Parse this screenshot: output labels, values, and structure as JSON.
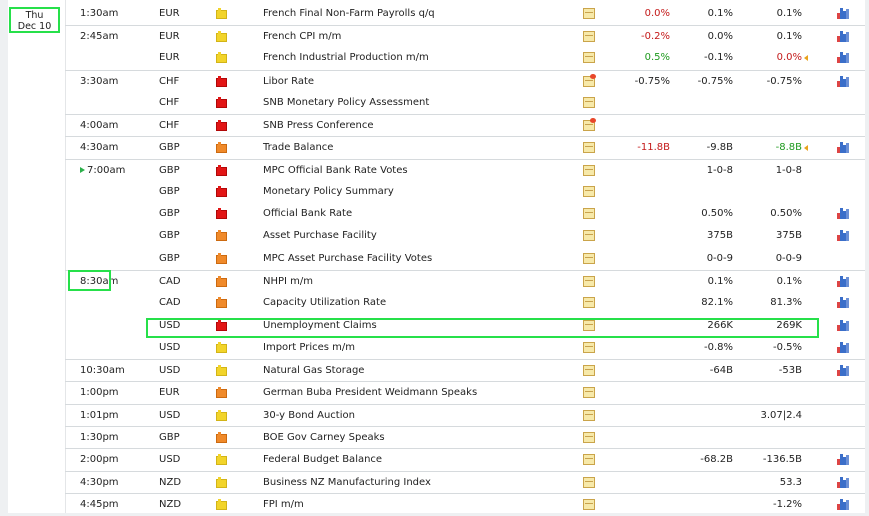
{
  "day": {
    "weekday": "Thu",
    "date": "Dec 10"
  },
  "rows": [
    {
      "time": "1:30am",
      "currency": "EUR",
      "impact": "low",
      "event": "French Final Non-Farm Payrolls q/q",
      "doc": "note",
      "actual": "0.0%",
      "actual_color": "red",
      "forecast": "0.1%",
      "previous": "0.1%",
      "previous_color": "",
      "chart": true,
      "sep": false
    },
    {
      "time": "2:45am",
      "currency": "EUR",
      "impact": "low",
      "event": "French CPI m/m",
      "doc": "note",
      "actual": "-0.2%",
      "actual_color": "red",
      "forecast": "0.0%",
      "previous": "0.1%",
      "previous_color": "",
      "chart": true,
      "sep": true
    },
    {
      "time": "",
      "currency": "EUR",
      "impact": "low",
      "event": "French Industrial Production m/m",
      "doc": "note",
      "actual": "0.5%",
      "actual_color": "green",
      "forecast": "-0.1%",
      "previous": "0.0%",
      "previous_color": "red",
      "revised": true,
      "chart": true,
      "sep": false
    },
    {
      "time": "3:30am",
      "currency": "CHF",
      "impact": "high",
      "event": "Libor Rate",
      "doc": "note-new",
      "actual": "-0.75%",
      "actual_color": "",
      "forecast": "-0.75%",
      "previous": "-0.75%",
      "previous_color": "",
      "chart": true,
      "sep": true
    },
    {
      "time": "",
      "currency": "CHF",
      "impact": "high",
      "event": "SNB Monetary Policy Assessment",
      "doc": "note",
      "actual": "",
      "actual_color": "",
      "forecast": "",
      "previous": "",
      "previous_color": "",
      "chart": false,
      "sep": false
    },
    {
      "time": "4:00am",
      "currency": "CHF",
      "impact": "high",
      "event": "SNB Press Conference",
      "doc": "note-new",
      "actual": "",
      "actual_color": "",
      "forecast": "",
      "previous": "",
      "previous_color": "",
      "chart": false,
      "sep": true
    },
    {
      "time": "4:30am",
      "currency": "GBP",
      "impact": "medium",
      "event": "Trade Balance",
      "doc": "note",
      "actual": "-11.8B",
      "actual_color": "red",
      "forecast": "-9.8B",
      "previous": "-8.8B",
      "previous_color": "green",
      "revised": true,
      "chart": true,
      "sep": true
    },
    {
      "time": "7:00am",
      "currency": "GBP",
      "impact": "high",
      "event": "MPC Official Bank Rate Votes",
      "doc": "note",
      "actual": "",
      "actual_color": "",
      "forecast": "1-0-8",
      "previous": "1-0-8",
      "previous_color": "",
      "chart": false,
      "sep": true,
      "playing": true
    },
    {
      "time": "",
      "currency": "GBP",
      "impact": "high",
      "event": "Monetary Policy Summary",
      "doc": "note",
      "actual": "",
      "actual_color": "",
      "forecast": "",
      "previous": "",
      "previous_color": "",
      "chart": false,
      "sep": false
    },
    {
      "time": "",
      "currency": "GBP",
      "impact": "high",
      "event": "Official Bank Rate",
      "doc": "note",
      "actual": "",
      "actual_color": "",
      "forecast": "0.50%",
      "previous": "0.50%",
      "previous_color": "",
      "chart": true,
      "sep": false
    },
    {
      "time": "",
      "currency": "GBP",
      "impact": "medium",
      "event": "Asset Purchase Facility",
      "doc": "note",
      "actual": "",
      "actual_color": "",
      "forecast": "375B",
      "previous": "375B",
      "previous_color": "",
      "chart": true,
      "sep": false
    },
    {
      "time": "",
      "currency": "GBP",
      "impact": "medium",
      "event": "MPC Asset Purchase Facility Votes",
      "doc": "note",
      "actual": "",
      "actual_color": "",
      "forecast": "0-0-9",
      "previous": "0-0-9",
      "previous_color": "",
      "chart": false,
      "sep": false
    },
    {
      "time": "8:30am",
      "currency": "CAD",
      "impact": "medium",
      "event": "NHPI m/m",
      "doc": "note",
      "actual": "",
      "actual_color": "",
      "forecast": "0.1%",
      "previous": "0.1%",
      "previous_color": "",
      "chart": true,
      "sep": true
    },
    {
      "time": "",
      "currency": "CAD",
      "impact": "medium",
      "event": "Capacity Utilization Rate",
      "doc": "note",
      "actual": "",
      "actual_color": "",
      "forecast": "82.1%",
      "previous": "81.3%",
      "previous_color": "",
      "chart": true,
      "sep": false
    },
    {
      "time": "",
      "currency": "USD",
      "impact": "high",
      "event": "Unemployment Claims",
      "doc": "note",
      "actual": "",
      "actual_color": "",
      "forecast": "266K",
      "previous": "269K",
      "previous_color": "",
      "chart": true,
      "sep": false
    },
    {
      "time": "",
      "currency": "USD",
      "impact": "low",
      "event": "Import Prices m/m",
      "doc": "note",
      "actual": "",
      "actual_color": "",
      "forecast": "-0.8%",
      "previous": "-0.5%",
      "previous_color": "",
      "chart": true,
      "sep": false
    },
    {
      "time": "10:30am",
      "currency": "USD",
      "impact": "low",
      "event": "Natural Gas Storage",
      "doc": "note",
      "actual": "",
      "actual_color": "",
      "forecast": "-64B",
      "previous": "-53B",
      "previous_color": "",
      "chart": true,
      "sep": true
    },
    {
      "time": "1:00pm",
      "currency": "EUR",
      "impact": "medium",
      "event": "German Buba President Weidmann Speaks",
      "doc": "note",
      "actual": "",
      "actual_color": "",
      "forecast": "",
      "previous": "",
      "previous_color": "",
      "chart": false,
      "sep": true
    },
    {
      "time": "1:01pm",
      "currency": "USD",
      "impact": "low",
      "event": "30-y Bond Auction",
      "doc": "note",
      "actual": "",
      "actual_color": "",
      "forecast": "",
      "previous": "3.07|2.4",
      "previous_color": "",
      "chart": false,
      "sep": true
    },
    {
      "time": "1:30pm",
      "currency": "GBP",
      "impact": "medium",
      "event": "BOE Gov Carney Speaks",
      "doc": "note",
      "actual": "",
      "actual_color": "",
      "forecast": "",
      "previous": "",
      "previous_color": "",
      "chart": false,
      "sep": true
    },
    {
      "time": "2:00pm",
      "currency": "USD",
      "impact": "low",
      "event": "Federal Budget Balance",
      "doc": "note",
      "actual": "",
      "actual_color": "",
      "forecast": "-68.2B",
      "previous": "-136.5B",
      "previous_color": "",
      "chart": true,
      "sep": true
    },
    {
      "time": "4:30pm",
      "currency": "NZD",
      "impact": "low",
      "event": "Business NZ Manufacturing Index",
      "doc": "note",
      "actual": "",
      "actual_color": "",
      "forecast": "",
      "previous": "53.3",
      "previous_color": "",
      "chart": true,
      "sep": true
    },
    {
      "time": "4:45pm",
      "currency": "NZD",
      "impact": "low",
      "event": "FPI m/m",
      "doc": "note",
      "actual": "",
      "actual_color": "",
      "forecast": "",
      "previous": "-1.2%",
      "previous_color": "",
      "chart": true,
      "sep": true
    }
  ],
  "colors": {
    "highlight": "#26e04a",
    "positive": "#1e9a1e",
    "negative": "#c41a1a",
    "impact_low": "#f2d42a",
    "impact_medium": "#f08a2a",
    "impact_high": "#e21515"
  }
}
